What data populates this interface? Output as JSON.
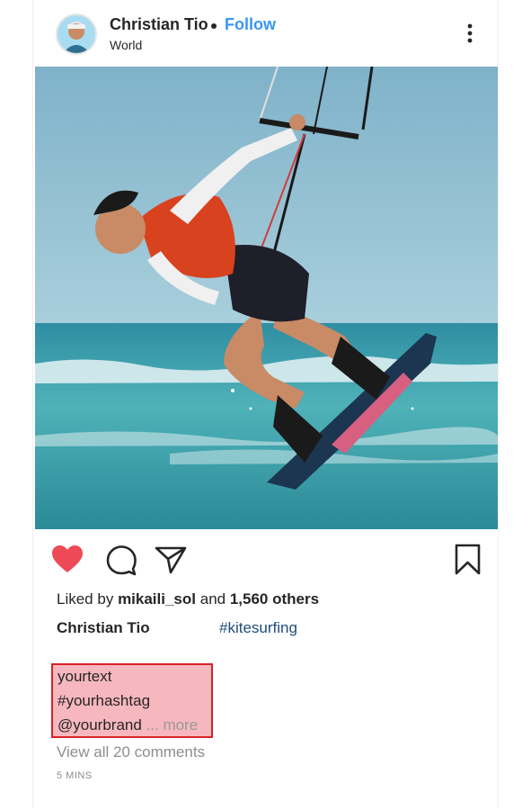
{
  "post": {
    "username": "Christian Tio",
    "follow_label": "Follow",
    "location": "World",
    "icons": {
      "avatar": "profile-avatar",
      "more": "more-options-icon",
      "like": "heart-icon",
      "comment": "comment-icon",
      "share": "paper-plane-icon",
      "save": "bookmark-icon"
    },
    "likes": {
      "prefix": "Liked by",
      "user": "mikaili_sol",
      "middle": "and",
      "count": "1,560 others"
    },
    "caption": {
      "user": "Christian Tio",
      "hashtag": "#kitesurfing"
    },
    "highlight": {
      "line1": "yourtext",
      "line2": "#yourhashtag",
      "line3": "@yourbrand",
      "more": "... more"
    },
    "comments": {
      "prefix": "View all",
      "count_text": "20 comments"
    },
    "time": "5 MINS",
    "colors": {
      "like": "#ed4956",
      "follow": "#3897f0",
      "highlight_fill": "#f7b7bf",
      "highlight_border": "#d8232a"
    }
  }
}
